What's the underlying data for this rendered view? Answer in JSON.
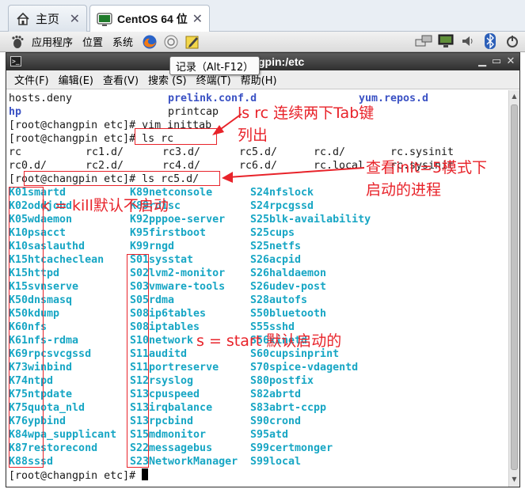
{
  "tabs": [
    {
      "label": "主页",
      "icon": "home-icon"
    },
    {
      "label": "CentOS 64 位",
      "icon": "vm-icon"
    }
  ],
  "panel": {
    "menus": [
      "应用程序",
      "位置",
      "系统"
    ],
    "launchers": [
      "firefox-icon",
      "mail-icon",
      "notes-icon"
    ],
    "tray": [
      "network-icon",
      "display-icon",
      "volume-icon",
      "bluetooth-icon",
      "power-icon"
    ]
  },
  "window": {
    "title": "gpin:/etc",
    "tooltip": "记录（Alt-F12）",
    "menu": [
      "文件(F)",
      "编辑(E)",
      "查看(V)",
      "搜索 (S)",
      "终端(T)",
      "帮助(H)"
    ]
  },
  "terminal": {
    "top_lines": [
      {
        "c1": "hosts.deny",
        "c2": "prelink.conf.d",
        "c3": "yum.repos.d"
      },
      {
        "c1": "hp",
        "c2": "printcap",
        "c3": ""
      }
    ],
    "cmd1": "[root@changpin etc]# vim inittab",
    "cmd2": "[root@changpin etc]# ls rc",
    "rc_row1": [
      "rc",
      "rc1.d/",
      "rc3.d/",
      "rc5.d/",
      "rc.d/",
      "rc.sysinit"
    ],
    "rc_row2": [
      "rc0.d/",
      "rc2.d/",
      "rc4.d/",
      "rc6.d/",
      "rc.local",
      "rc.sysinit"
    ],
    "cmd3": "[root@changpin etc]# ls rc5.d/",
    "col1": [
      "K01smartd",
      "K02oddjobd",
      "K05wdaemon",
      "K10psacct",
      "K10saslauthd",
      "K15htcacheclean",
      "K15httpd",
      "K15svnserve",
      "K50dnsmasq",
      "K50kdump",
      "K60nfs",
      "K61nfs-rdma",
      "K69rpcsvcgssd",
      "K73winbind",
      "K74ntpd",
      "K75ntpdate",
      "K75quota_nld",
      "K76ypbind",
      "K84wpa_supplicant",
      "K87restorecond",
      "K88sssd"
    ],
    "col2": [
      "K89netconsole",
      "K89rdisc",
      "K92pppoe-server",
      "K95firstboot",
      "K99rngd",
      "S01sysstat",
      "S02lvm2-monitor",
      "S03vmware-tools",
      "S05rdma",
      "S08ip6tables",
      "S08iptables",
      "S10network",
      "S11auditd",
      "S11portreserve",
      "S12rsyslog",
      "S13cpuspeed",
      "S13irqbalance",
      "S13rpcbind",
      "S15mdmonitor",
      "S22messagebus",
      "S23NetworkManager"
    ],
    "col3": [
      "S24nfslock",
      "S24rpcgssd",
      "S25blk-availability",
      "S25cups",
      "S25netfs",
      "S26acpid",
      "S26haldaemon",
      "S26udev-post",
      "S28autofs",
      "S50bluetooth",
      "S55sshd",
      "S56xinetd",
      "S60cupsinprint",
      "S70spice-vdagentd",
      "S80postfix",
      "S82abrtd",
      "S83abrt-ccpp",
      "S90crond",
      "S95atd",
      "S99certmonger",
      "S99local"
    ],
    "prompt": "[root@changpin etc]#"
  },
  "annotations": {
    "ls_rc_line1": "ls rc 连续两下Tab键",
    "ls_rc_line2": "列出",
    "init5_line1": "查看init=5模式下",
    "init5_line2": "启动的进程",
    "kill": "k = kill默认不启动",
    "start": "s = start 默认启动的"
  },
  "colors": {
    "annotation": "#e8232a",
    "service_name": "#17a6c4",
    "directory": "#3b52c4"
  }
}
